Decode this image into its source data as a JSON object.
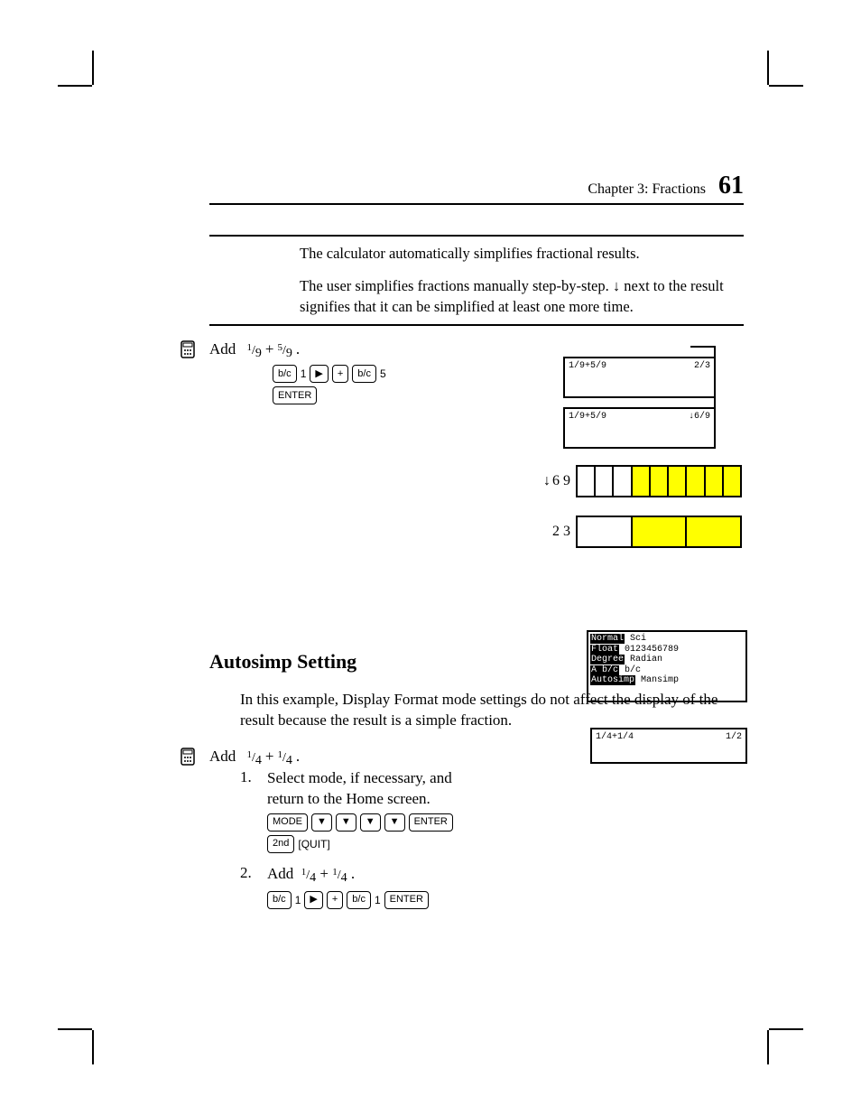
{
  "header": {
    "chapter_label": "Chapter 3: Fractions",
    "page_number": "61"
  },
  "autosimp_table": {
    "row1": {
      "label": "",
      "text": "The calculator automatically simplifies fractional results."
    },
    "row2": {
      "label": "",
      "text": "The user simplifies fractions manually step-by-step. ↓ next to the result signifies that it can be simplified at least one more time."
    }
  },
  "example1": {
    "lead": "Add",
    "frac1_n": "1",
    "frac1_d": "9",
    "plus": " + ",
    "frac2_n": "5",
    "frac2_d": "9",
    "trail": ".",
    "keys": [
      "b/c",
      "1",
      "▶",
      "+",
      "b/c",
      "5",
      "ENTER"
    ]
  },
  "screens1": {
    "top_left": "1/9+5/9",
    "top_right": "2/3",
    "bottom_left": "1/9+5/9",
    "bottom_right": "↓6/9"
  },
  "chart_data": {
    "type": "bar",
    "title": "",
    "rows": [
      {
        "label_arrow": "↓",
        "label_n": "6",
        "label_d": "9",
        "slots": 9,
        "filled": [
          3,
          4,
          5,
          6,
          7,
          8
        ]
      },
      {
        "label_arrow": "",
        "label_n": "2",
        "label_d": "3",
        "slots": 3,
        "filled": [
          1,
          2
        ]
      }
    ]
  },
  "section": {
    "heading": "Autosimp Setting",
    "intro": "In this example, Display Format mode settings do not affect the display of the result because the result is a simple fraction."
  },
  "example2": {
    "lead": "Add",
    "frac1_n": "1",
    "frac1_d": "4",
    "plus": " + ",
    "frac2_n": "1",
    "frac2_d": "4",
    "trail": "."
  },
  "step1": {
    "num": "1.",
    "text_a": "Select ",
    "text_b": " mode, if necessary, and return to the Home screen.",
    "keys": [
      "MODE",
      "▼",
      "▼",
      "▼",
      "▼",
      "ENTER"
    ],
    "keys2": [
      "2nd",
      "[QUIT]"
    ]
  },
  "step2": {
    "num": "2.",
    "lead": "Add",
    "frac1_n": "1",
    "frac1_d": "4",
    "plus": " + ",
    "frac2_n": "1",
    "frac2_d": "4",
    "trail": ".",
    "keys": [
      "b/c",
      "1",
      "▶",
      "+",
      "b/c",
      "1",
      "ENTER"
    ]
  },
  "mode_screen": {
    "l1_a": "Normal",
    "l1_b": " Sci",
    "l2_a": "Float",
    "l2_b": " 0123456789",
    "l3_a": "Degree",
    "l3_b": " Radian",
    "l4_a": "A b/c",
    "l4_b": " b/c",
    "l5_a": "Autosimp",
    "l5_b": " Mansimp"
  },
  "result_screen2": {
    "left": "1/4+1/4",
    "right": "1/2"
  },
  "icons": {
    "calc": "calculator-icon"
  }
}
